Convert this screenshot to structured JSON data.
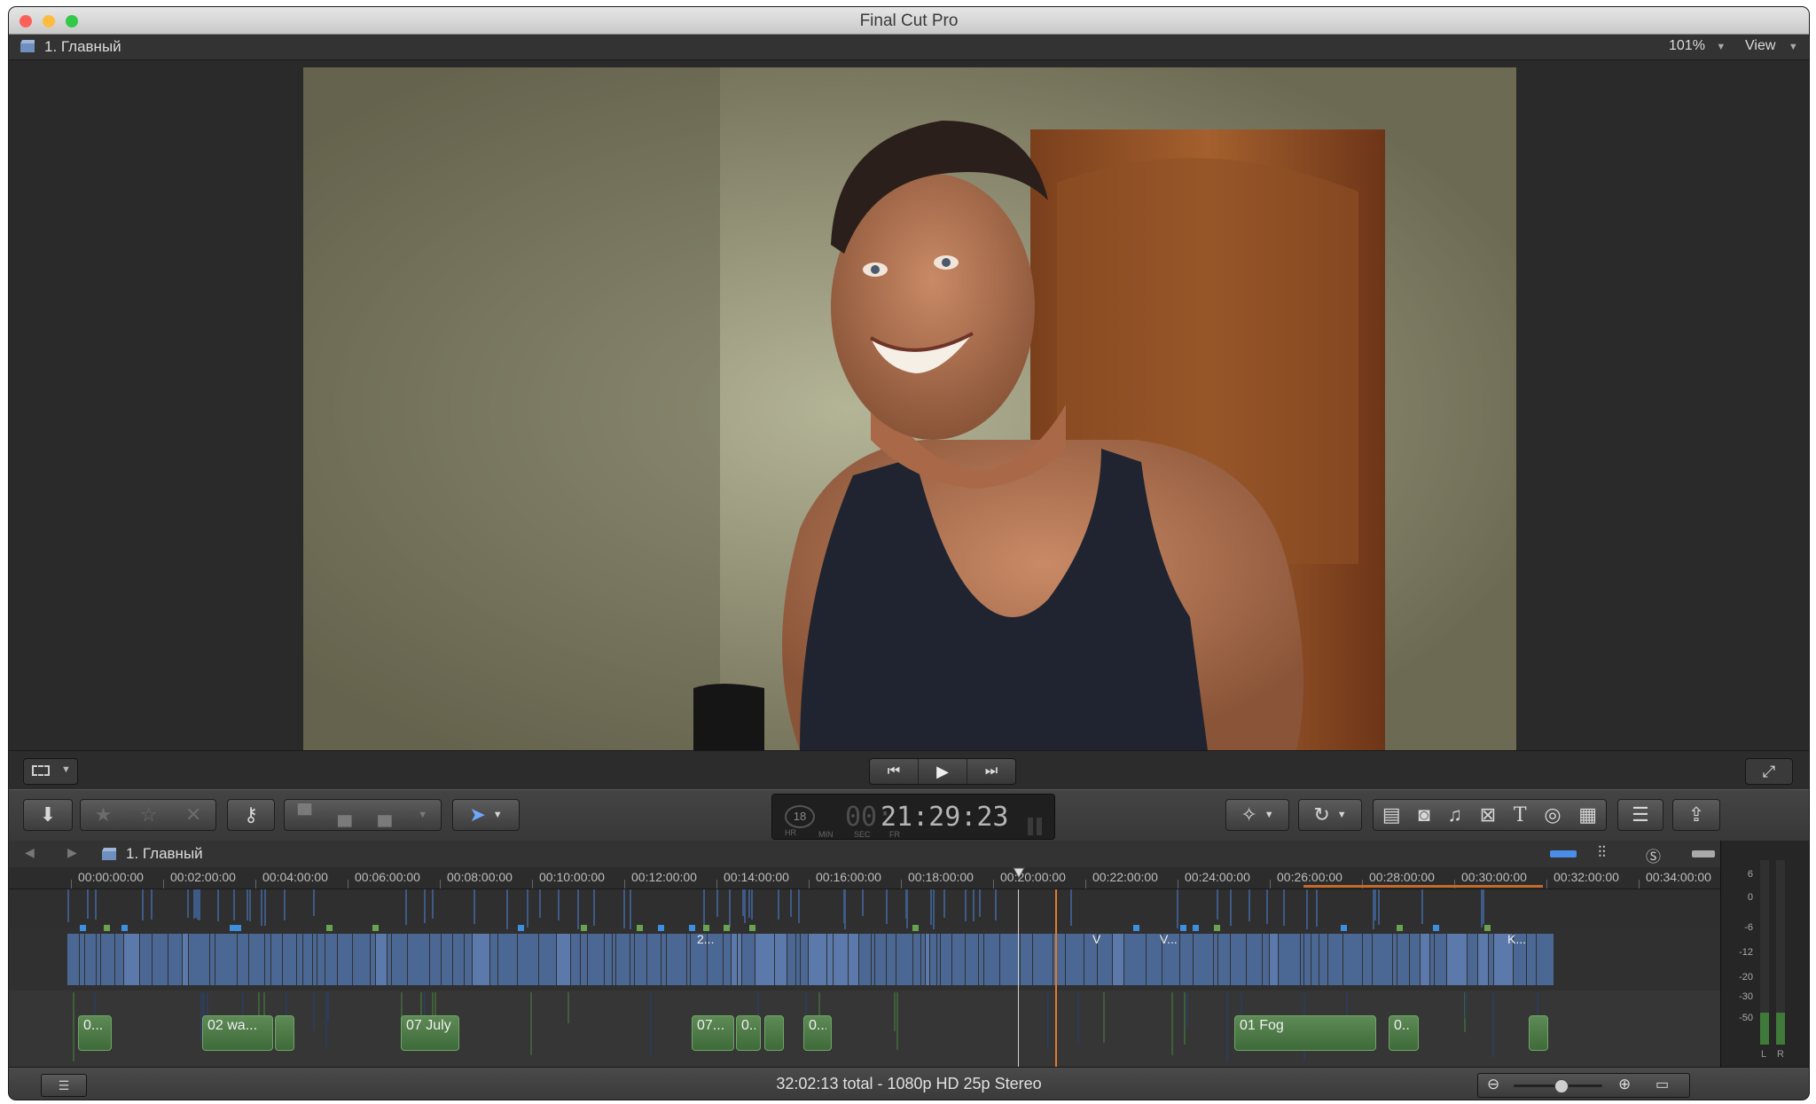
{
  "window": {
    "title": "Final Cut Pro",
    "colors": {
      "close": "#fc605c",
      "minimize": "#fdbc40",
      "zoom": "#34c84a"
    }
  },
  "viewer": {
    "project_name": "1. Главный",
    "zoom": "101%",
    "view_menu": "View"
  },
  "toolbar": {
    "timecode": "21:29:23",
    "timecode_prefix": "00:",
    "timecode_sublabels": [
      "HR",
      "MIN",
      "SEC",
      "FR"
    ],
    "timecode_badge": "18",
    "title_icon": "T"
  },
  "timeline": {
    "project_name": "1. Главный",
    "ruler_ticks": [
      "00:00:00:00",
      "00:02:00:00",
      "00:04:00:00",
      "00:06:00:00",
      "00:08:00:00",
      "00:10:00:00",
      "00:12:00:00",
      "00:14:00:00",
      "00:16:00:00",
      "00:18:00:00",
      "00:20:00:00",
      "00:22:00:00",
      "00:24:00:00",
      "00:26:00:00",
      "00:28:00:00",
      "00:30:00:00",
      "00:32:00:00",
      "00:34:00:00"
    ],
    "video_clip_labels": [
      "2...",
      "V",
      "V...",
      "K..."
    ],
    "audio_clips": [
      "0...",
      "02 wa...",
      "07 July",
      "07...",
      "0...",
      "0...",
      "01 Fog",
      "0.."
    ]
  },
  "audio_meter": {
    "scale": [
      "6",
      "0",
      "-6",
      "-12",
      "-20",
      "-30",
      "-50"
    ],
    "channels": [
      "L",
      "R"
    ]
  },
  "status_bar": {
    "summary": "32:02:13 total - 1080p HD 25p Stereo"
  }
}
